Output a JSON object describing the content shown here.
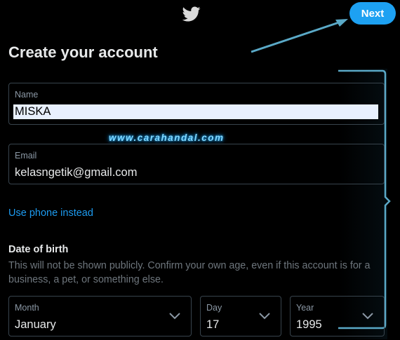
{
  "header": {
    "logo_icon": "twitter-bird-icon",
    "next_label": "Next"
  },
  "title": "Create your account",
  "name": {
    "label": "Name",
    "value": "MISKA"
  },
  "email": {
    "label": "Email",
    "value": "kelasngetik@gmail.com"
  },
  "phone_link": "Use phone instead",
  "dob": {
    "title": "Date of birth",
    "description": "This will not be shown publicly. Confirm your own age, even if this account is for a business, a pet, or something else.",
    "month": {
      "label": "Month",
      "value": "January"
    },
    "day": {
      "label": "Day",
      "value": "17"
    },
    "year": {
      "label": "Year",
      "value": "1995"
    }
  },
  "watermark": "www.carahandal.com",
  "colors": {
    "accent": "#1da1f2",
    "background": "#000000",
    "border": "#38444d"
  }
}
